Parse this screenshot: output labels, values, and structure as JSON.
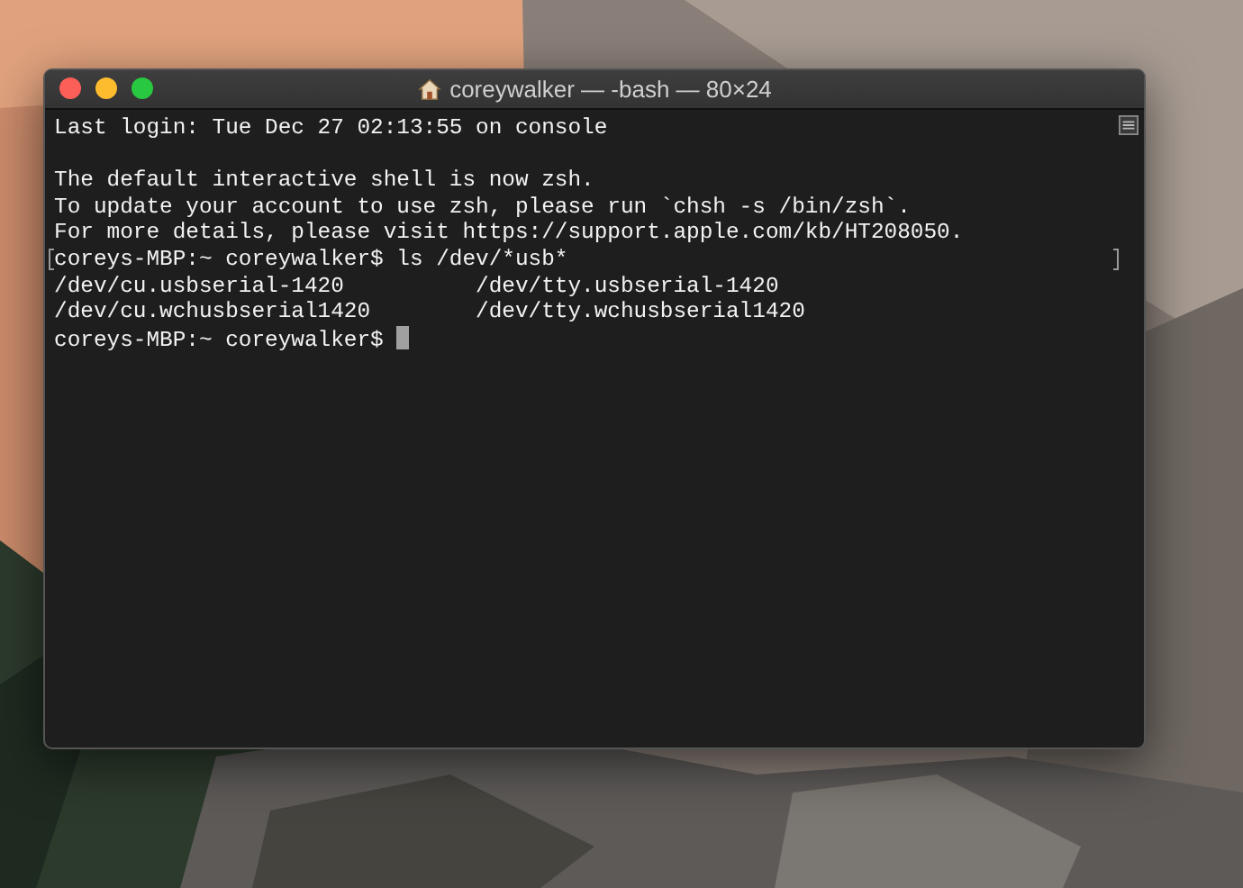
{
  "window": {
    "title": "coreywalker — -bash — 80×24"
  },
  "terminal": {
    "lines": [
      {
        "kind": "text",
        "text": "Last login: Tue Dec 27 02:13:55 on console",
        "marked": false
      },
      {
        "kind": "blank"
      },
      {
        "kind": "text",
        "text": "The default interactive shell is now zsh.",
        "marked": false
      },
      {
        "kind": "text",
        "text": "To update your account to use zsh, please run `chsh -s /bin/zsh`.",
        "marked": false
      },
      {
        "kind": "text",
        "text": "For more details, please visit https://support.apple.com/kb/HT208050.",
        "marked": false
      },
      {
        "kind": "text",
        "text": "coreys-MBP:~ coreywalker$ ls /dev/*usb*",
        "marked": true
      },
      {
        "kind": "text",
        "text": "/dev/cu.usbserial-1420          /dev/tty.usbserial-1420",
        "marked": false
      },
      {
        "kind": "text",
        "text": "/dev/cu.wchusbserial1420        /dev/tty.wchusbserial1420",
        "marked": false
      },
      {
        "kind": "prompt",
        "text": "coreys-MBP:~ coreywalker$ ",
        "cursor": true
      }
    ]
  }
}
